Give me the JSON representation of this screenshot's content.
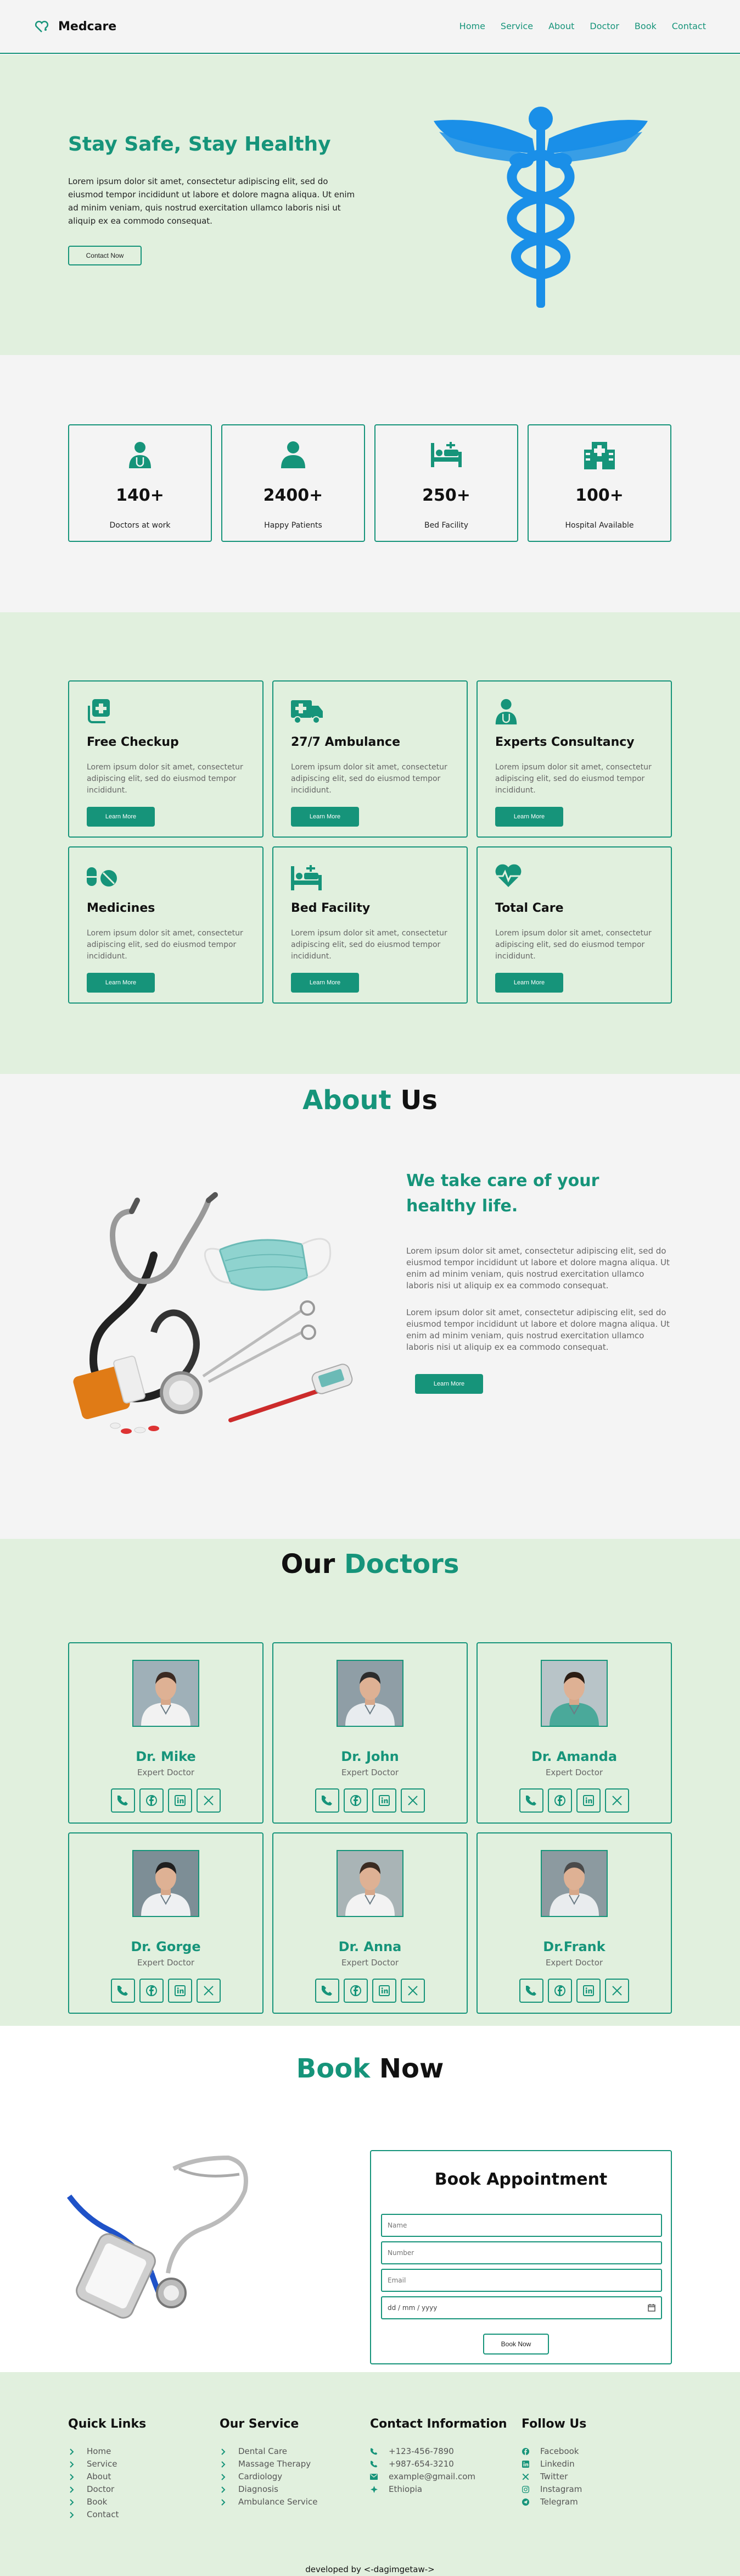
{
  "header": {
    "brand": "Medcare",
    "nav": [
      "Home",
      "Service",
      "About",
      "Doctor",
      "Book",
      "Contact"
    ]
  },
  "hero": {
    "title": "Stay Safe, Stay Healthy",
    "text": "Lorem ipsum dolor sit amet, consectetur adipiscing elit, sed do eiusmod tempor incididunt ut labore et dolore magna aliqua. Ut enim ad minim veniam, quis nostrud exercitation ullamco laboris nisi ut aliquip ex ea commodo consequat.",
    "button": "Contact Now"
  },
  "stats": [
    {
      "icon": "doctor-icon",
      "number": "140+",
      "label": "Doctors at work"
    },
    {
      "icon": "patient-icon",
      "number": "2400+",
      "label": "Happy Patients"
    },
    {
      "icon": "bed-icon",
      "number": "250+",
      "label": "Bed Facility"
    },
    {
      "icon": "hospital-icon",
      "number": "100+",
      "label": "Hospital Available"
    }
  ],
  "services": [
    {
      "icon": "checkup-icon",
      "title": "Free Checkup",
      "text": "Lorem ipsum dolor sit amet, consectetur adipiscing elit, sed do eiusmod tempor incididunt.",
      "button": "Learn More"
    },
    {
      "icon": "ambulance-icon",
      "title": "27/7 Ambulance",
      "text": "Lorem ipsum dolor sit amet, consectetur adipiscing elit, sed do eiusmod tempor incididunt.",
      "button": "Learn More"
    },
    {
      "icon": "doctor-icon",
      "title": "Experts Consultancy",
      "text": "Lorem ipsum dolor sit amet, consectetur adipiscing elit, sed do eiusmod tempor incididunt.",
      "button": "Learn More"
    },
    {
      "icon": "pills-icon",
      "title": "Medicines",
      "text": "Lorem ipsum dolor sit amet, consectetur adipiscing elit, sed do eiusmod tempor incididunt.",
      "button": "Learn More"
    },
    {
      "icon": "bed-icon",
      "title": "Bed Facility",
      "text": "Lorem ipsum dolor sit amet, consectetur adipiscing elit, sed do eiusmod tempor incididunt.",
      "button": "Learn More"
    },
    {
      "icon": "heart-pulse-icon",
      "title": "Total Care",
      "text": "Lorem ipsum dolor sit amet, consectetur adipiscing elit, sed do eiusmod tempor incididunt.",
      "button": "Learn More"
    }
  ],
  "about": {
    "title_accent": "About",
    "title_rest": " Us",
    "subtitle": "We take care of your healthy life.",
    "p1": "Lorem ipsum dolor sit amet, consectetur adipiscing elit, sed do eiusmod tempor incididunt ut labore et dolore magna aliqua. Ut enim ad minim veniam, quis nostrud exercitation ullamco laboris nisi ut aliquip ex ea commodo consequat.",
    "p2": "Lorem ipsum dolor sit amet, consectetur adipiscing elit, sed do eiusmod tempor incididunt ut labore et dolore magna aliqua. Ut enim ad minim veniam, quis nostrud exercitation ullamco laboris nisi ut aliquip ex ea commodo consequat.",
    "button": "Learn More"
  },
  "doctors": {
    "title_rest": "Our ",
    "title_accent": "Doctors",
    "list": [
      {
        "name": "Dr. Mike",
        "role": "Expert Doctor"
      },
      {
        "name": "Dr. John",
        "role": "Expert Doctor"
      },
      {
        "name": "Dr. Amanda",
        "role": "Expert Doctor"
      },
      {
        "name": "Dr. Gorge",
        "role": "Expert Doctor"
      },
      {
        "name": "Dr. Anna",
        "role": "Expert Doctor"
      },
      {
        "name": "Dr.Frank",
        "role": "Expert Doctor"
      }
    ],
    "social_icons": [
      "phone-icon",
      "facebook-icon",
      "linkedin-icon",
      "x-icon"
    ]
  },
  "book": {
    "title_accent": "Book",
    "title_rest": " Now",
    "form_title": "Book Appointment",
    "name_placeholder": "Name",
    "number_placeholder": "Number",
    "email_placeholder": "Email",
    "date_placeholder": "dd / mm / yyyy",
    "submit": "Book Now"
  },
  "footer": {
    "quick_links": {
      "title": "Quick Links",
      "items": [
        "Home",
        "Service",
        "About",
        "Doctor",
        "Book",
        "Contact"
      ]
    },
    "our_service": {
      "title": "Our Service",
      "items": [
        "Dental Care",
        "Massage Therapy",
        "Cardiology",
        "Diagnosis",
        "Ambulance Service"
      ]
    },
    "contact": {
      "title": "Contact Information",
      "items": [
        "+123-456-7890",
        "+987-654-3210",
        "example@gmail.com",
        "Ethiopia"
      ]
    },
    "follow": {
      "title": "Follow Us",
      "items": [
        "Facebook",
        "Linkedin",
        "Twitter",
        "Instagram",
        "Telegram"
      ]
    },
    "credit": "developed by <-dagimgetaw->"
  },
  "colors": {
    "accent": "#16947a",
    "light_green": "#e1f0de",
    "grey": "#f4f4f4",
    "caduceus": "#1a8fe8"
  }
}
